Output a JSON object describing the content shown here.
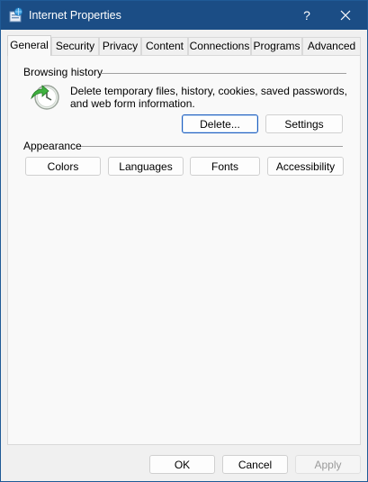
{
  "window": {
    "title": "Internet Properties",
    "help_label": "?",
    "icon": "internet-options-icon"
  },
  "tabs": [
    {
      "label": "General",
      "active": true
    },
    {
      "label": "Security",
      "active": false
    },
    {
      "label": "Privacy",
      "active": false
    },
    {
      "label": "Content",
      "active": false
    },
    {
      "label": "Connections",
      "active": false
    },
    {
      "label": "Programs",
      "active": false
    },
    {
      "label": "Advanced",
      "active": false
    }
  ],
  "browsing_history": {
    "heading": "Browsing history",
    "icon": "history-clock-icon",
    "description": "Delete temporary files, history, cookies, saved passwords, and web form information.",
    "delete_label": "Delete...",
    "settings_label": "Settings"
  },
  "appearance": {
    "heading": "Appearance",
    "colors_label": "Colors",
    "languages_label": "Languages",
    "fonts_label": "Fonts",
    "accessibility_label": "Accessibility"
  },
  "footer": {
    "ok_label": "OK",
    "cancel_label": "Cancel",
    "apply_label": "Apply"
  },
  "colors": {
    "titlebar": "#1b4d85",
    "accent": "#1f5fbf",
    "panel": "#f9f9f9"
  }
}
